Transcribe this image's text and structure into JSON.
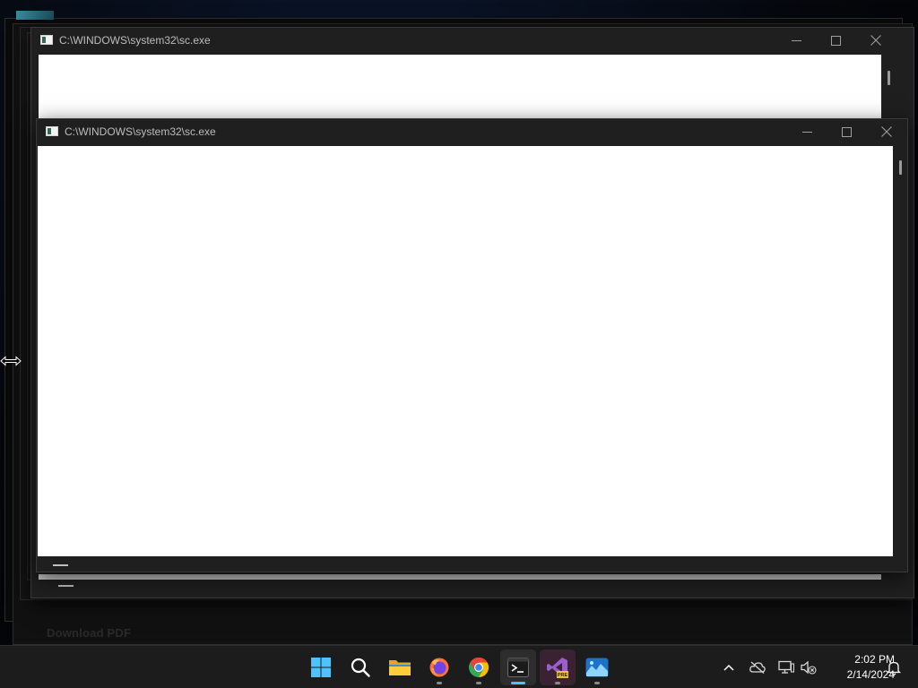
{
  "windows": {
    "back": {
      "title": "C:\\WINDOWS\\system32\\sc.exe"
    },
    "front": {
      "title": "C:\\WINDOWS\\system32\\sc.exe"
    }
  },
  "background_text": "Download PDF",
  "taskbar": {
    "apps": [
      {
        "name": "Start",
        "icon": "windows-logo-icon",
        "running": false
      },
      {
        "name": "Search",
        "icon": "search-icon",
        "running": false
      },
      {
        "name": "File Explorer",
        "icon": "folder-icon",
        "running": false
      },
      {
        "name": "Firefox",
        "icon": "firefox-icon",
        "running": true
      },
      {
        "name": "Chrome",
        "icon": "chrome-icon",
        "running": true
      },
      {
        "name": "Terminal",
        "icon": "terminal-icon",
        "running": true,
        "active": true
      },
      {
        "name": "Visual Studio Preview",
        "icon": "visual-studio-preview-icon",
        "running": true
      },
      {
        "name": "Photos",
        "icon": "photos-icon",
        "running": true
      }
    ],
    "tray": {
      "icons": [
        "chevron-up-icon",
        "onedrive-offline-icon",
        "network-icon",
        "volume-muted-icon"
      ],
      "time": "2:02 PM",
      "date": "2/14/2024",
      "notification_icon": "bell-icon"
    }
  },
  "colors": {
    "accent": "#4cc2ff",
    "titlebar": "#1f1f1f",
    "taskbar": "#1c1c1c"
  }
}
